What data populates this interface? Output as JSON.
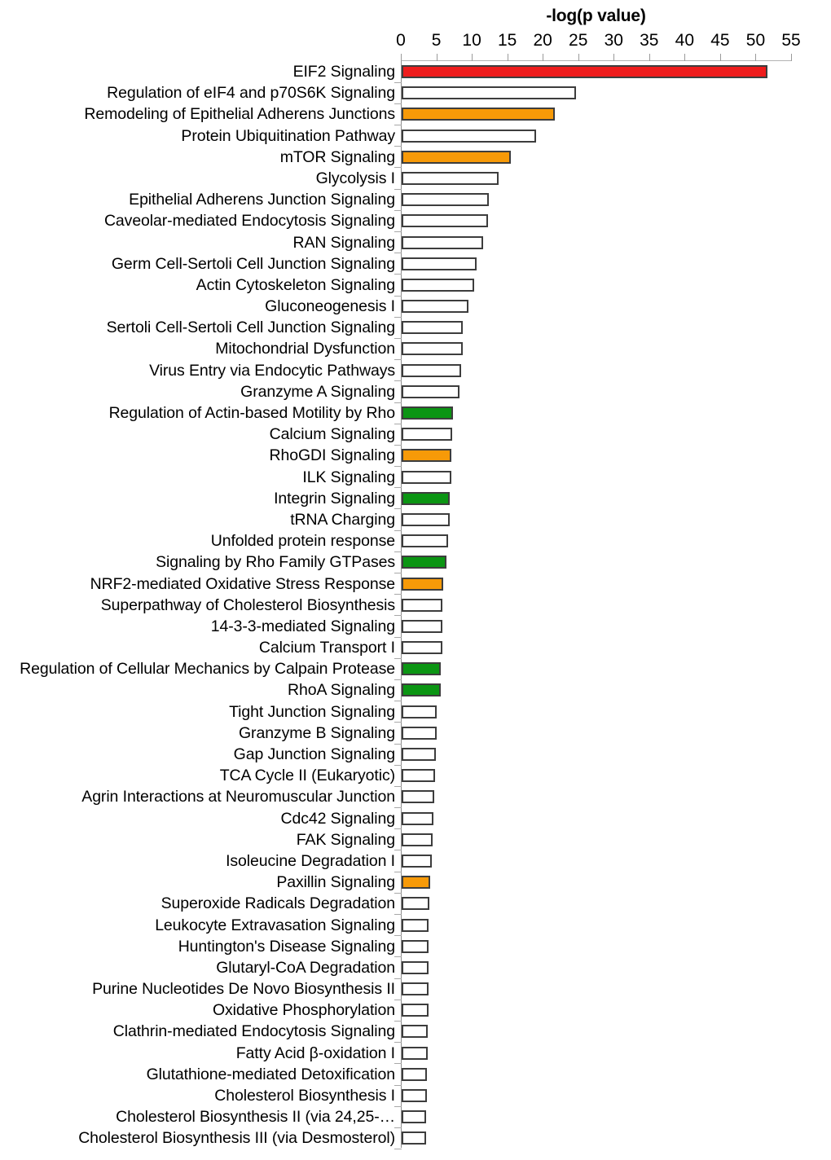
{
  "chart_data": {
    "type": "bar",
    "orientation": "horizontal",
    "title": "",
    "xlabel": "-log(p value)",
    "ylabel": "",
    "xlim": [
      0,
      55
    ],
    "xticks": [
      0,
      5,
      10,
      15,
      20,
      25,
      30,
      35,
      40,
      45,
      50,
      55
    ],
    "grid": false,
    "legend": null,
    "colors": {
      "red": "#ee1c1c",
      "orange": "#f79a08",
      "green": "#0b9513",
      "white": "#ffffff",
      "bar_outline": "#3d3d3d",
      "axis": "#8d8d8d"
    },
    "categories": [
      "EIF2 Signaling",
      "Regulation of eIF4 and p70S6K Signaling",
      "Remodeling of Epithelial Adherens Junctions",
      "Protein Ubiquitination Pathway",
      "mTOR Signaling",
      "Glycolysis I",
      "Epithelial Adherens Junction Signaling",
      "Caveolar-mediated Endocytosis Signaling",
      "RAN Signaling",
      "Germ Cell-Sertoli Cell Junction Signaling",
      "Actin Cytoskeleton Signaling",
      "Gluconeogenesis I",
      "Sertoli Cell-Sertoli Cell Junction Signaling",
      "Mitochondrial Dysfunction",
      "Virus Entry via Endocytic Pathways",
      "Granzyme A Signaling",
      "Regulation of Actin-based Motility by Rho",
      "Calcium Signaling",
      "RhoGDI Signaling",
      "ILK Signaling",
      "Integrin Signaling",
      "tRNA Charging",
      "Unfolded protein response",
      "Signaling by Rho Family GTPases",
      "NRF2-mediated Oxidative Stress Response",
      "Superpathway of Cholesterol Biosynthesis",
      "14-3-3-mediated Signaling",
      "Calcium Transport I",
      "Regulation of Cellular Mechanics by Calpain Protease",
      "RhoA Signaling",
      "Tight Junction Signaling",
      "Granzyme B Signaling",
      "Gap Junction Signaling",
      "TCA Cycle II (Eukaryotic)",
      "Agrin Interactions at Neuromuscular Junction",
      "Cdc42 Signaling",
      "FAK Signaling",
      "Isoleucine Degradation I",
      "Paxillin Signaling",
      "Superoxide Radicals Degradation",
      "Leukocyte Extravasation Signaling",
      "Huntington's Disease Signaling",
      "Glutaryl-CoA Degradation",
      "Purine Nucleotides De Novo Biosynthesis II",
      "Oxidative Phosphorylation",
      "Clathrin-mediated Endocytosis Signaling",
      "Fatty Acid β-oxidation I",
      "Glutathione-mediated Detoxification",
      "Cholesterol Biosynthesis I",
      "Cholesterol Biosynthesis II (via 24,25-…",
      "Cholesterol Biosynthesis III (via Desmosterol)"
    ],
    "values": [
      51.6,
      24.6,
      21.6,
      19.0,
      15.4,
      13.7,
      12.3,
      12.2,
      11.5,
      10.6,
      10.2,
      9.4,
      8.6,
      8.6,
      8.4,
      8.2,
      7.2,
      7.1,
      7.0,
      7.0,
      6.8,
      6.8,
      6.5,
      6.3,
      5.8,
      5.7,
      5.7,
      5.7,
      5.5,
      5.5,
      4.9,
      4.9,
      4.8,
      4.7,
      4.6,
      4.5,
      4.4,
      4.2,
      4.0,
      3.9,
      3.8,
      3.8,
      3.8,
      3.8,
      3.8,
      3.7,
      3.7,
      3.6,
      3.6,
      3.5,
      3.4
    ],
    "bar_colors": [
      "red",
      "white",
      "orange",
      "white",
      "orange",
      "white",
      "white",
      "white",
      "white",
      "white",
      "white",
      "white",
      "white",
      "white",
      "white",
      "white",
      "green",
      "white",
      "orange",
      "white",
      "green",
      "white",
      "white",
      "green",
      "orange",
      "white",
      "white",
      "white",
      "green",
      "green",
      "white",
      "white",
      "white",
      "white",
      "white",
      "white",
      "white",
      "white",
      "orange",
      "white",
      "white",
      "white",
      "white",
      "white",
      "white",
      "white",
      "white",
      "white",
      "white",
      "white",
      "white"
    ]
  }
}
